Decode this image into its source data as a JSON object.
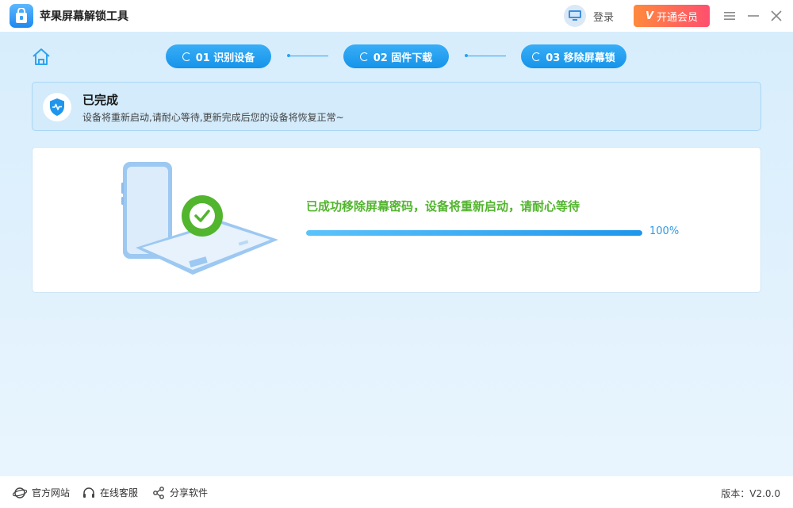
{
  "titlebar": {
    "app_title": "苹果屏幕解锁工具",
    "login_label": "登录",
    "vip_mark": "V",
    "vip_label": "开通会员",
    "icons": [
      "app-logo",
      "login-avatar-icon",
      "menu-icon",
      "minimize-icon",
      "close-icon"
    ]
  },
  "steps": [
    {
      "label": "01 识别设备"
    },
    {
      "label": "02 固件下载"
    },
    {
      "label": "03 移除屏幕锁"
    }
  ],
  "status": {
    "title": "已完成",
    "description": "设备将重新启动,请耐心等待,更新完成后您的设备将恢复正常~"
  },
  "result": {
    "message": "已成功移除屏幕密码，设备将重新启动，请耐心等待",
    "progress": 100,
    "progress_label": "100%"
  },
  "footer": {
    "official_site": "官方网站",
    "online_service": "在线客服",
    "share_software": "分享软件",
    "version": "版本：V2.0.0"
  },
  "colors": {
    "accent": "#1693ea",
    "success": "#52b52e",
    "vip_start": "#ff8a3d",
    "vip_end": "#ff4f6e"
  }
}
